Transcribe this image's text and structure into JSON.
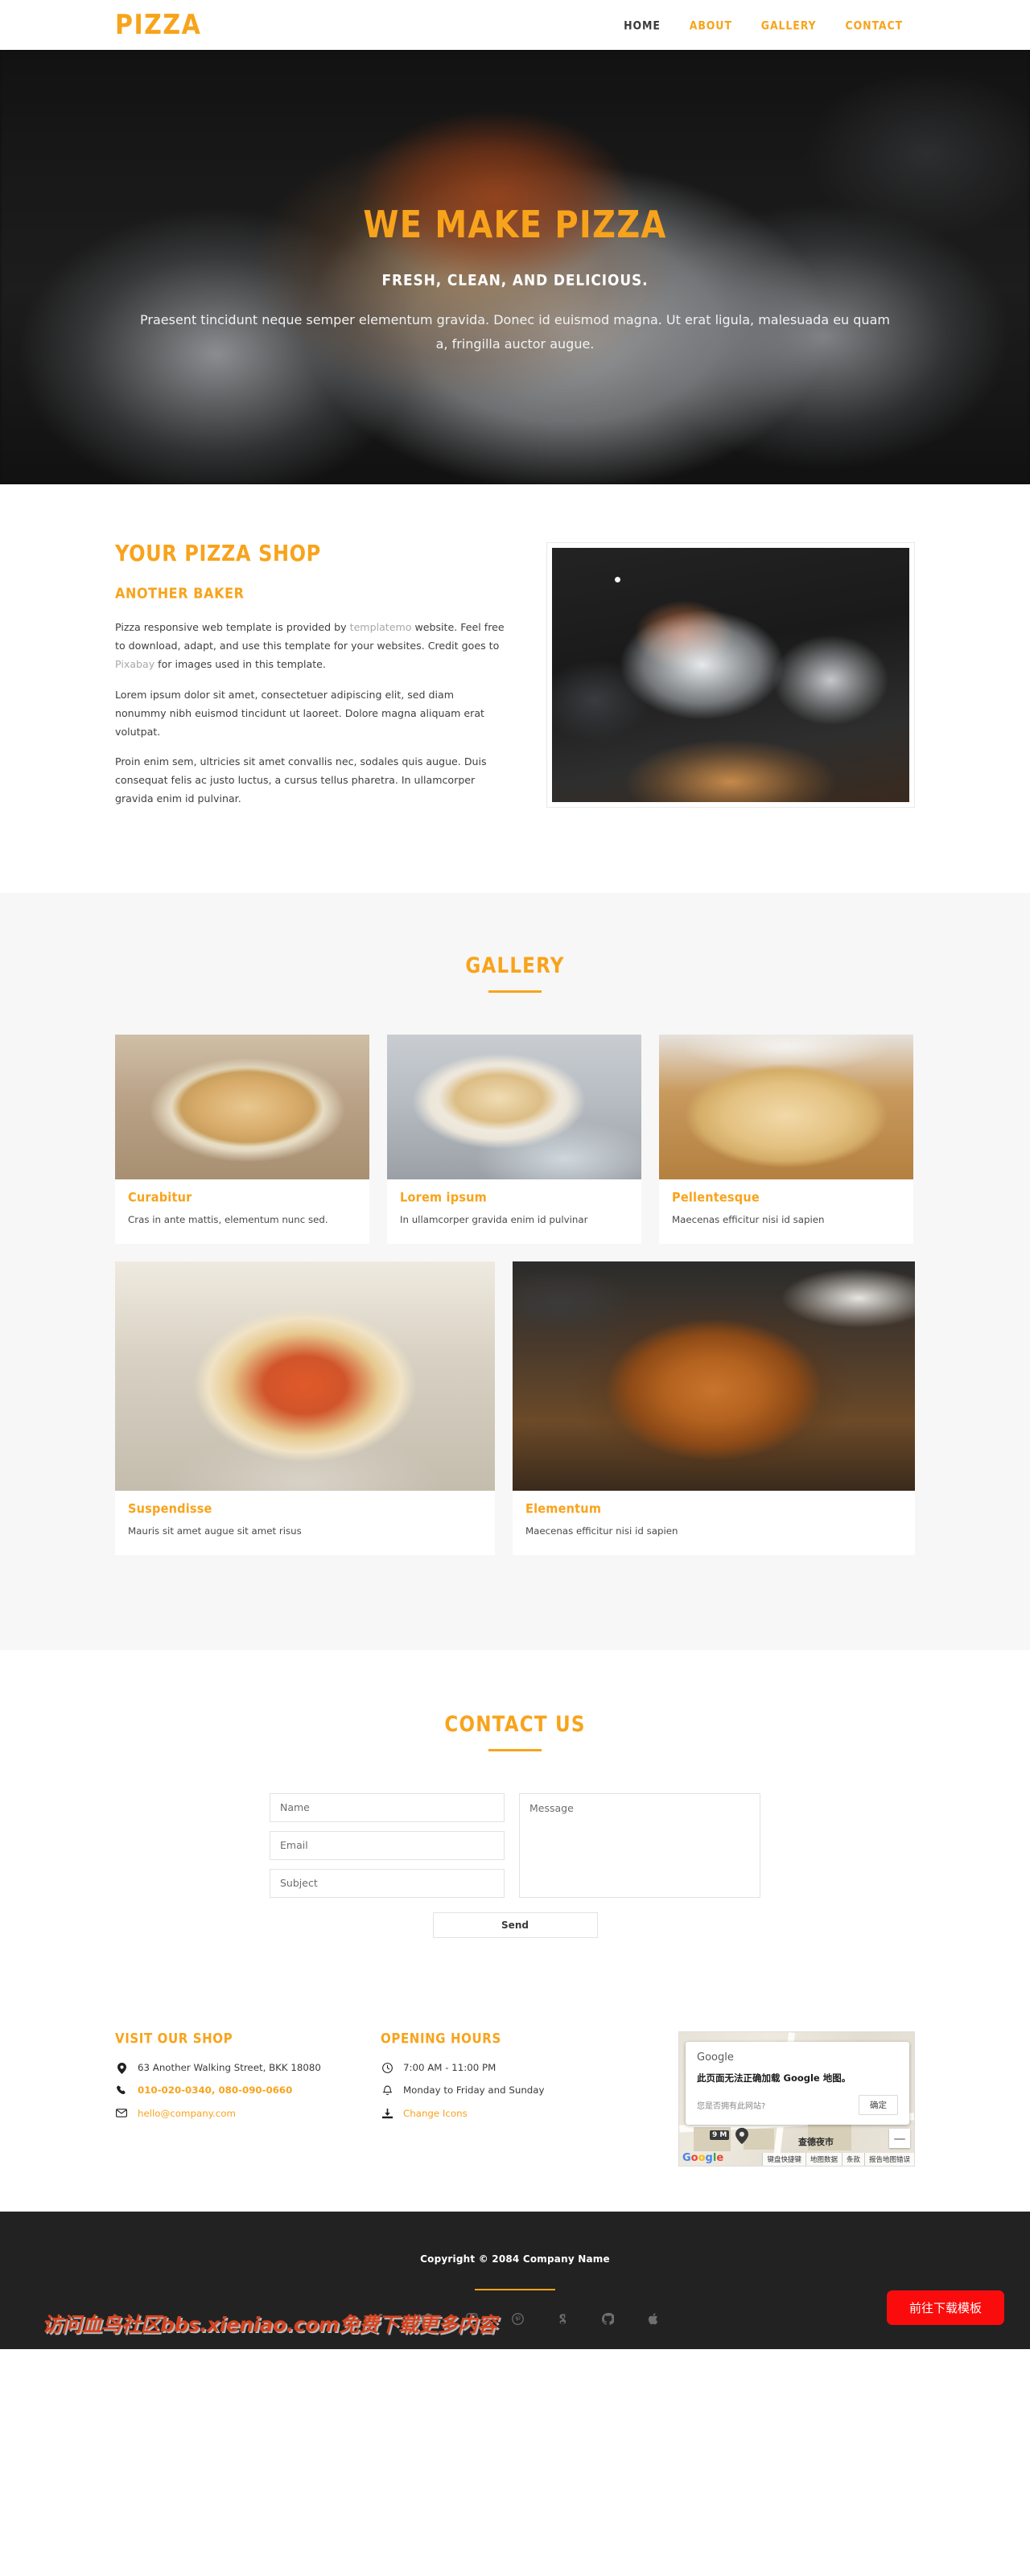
{
  "nav": {
    "brand": "PIZZA",
    "links": [
      {
        "label": "Home",
        "active": true
      },
      {
        "label": "About",
        "active": false
      },
      {
        "label": "Gallery",
        "active": false
      },
      {
        "label": "Contact",
        "active": false
      }
    ]
  },
  "hero": {
    "title": "We Make Pizza",
    "subtitle": "Fresh, Clean, and Delicious.",
    "description": "Praesent tincidunt neque semper elementum gravida. Donec id euismod magna. Ut erat ligula, malesuada eu quam a, fringilla auctor augue."
  },
  "about": {
    "title": "Your Pizza Shop",
    "subtitle": "Another Baker",
    "paragraph_1_a": "Pizza responsive web template is provided by ",
    "paragraph_1_link1": "templatemo",
    "paragraph_1_b": " website. Feel free to download, adapt, and use this template for your websites. Credit goes to ",
    "paragraph_1_link2": "Pixabay",
    "paragraph_1_c": " for images used in this template.",
    "paragraph_2": "Lorem ipsum dolor sit amet, consectetuer adipiscing elit, sed diam nonummy nibh euismod tincidunt ut laoreet. Dolore magna aliquam erat volutpat.",
    "paragraph_3": "Proin enim sem, ultricies sit amet convallis nec, sodales quis augue. Duis consequat felis ac justo luctus, a cursus tellus pharetra. In ullamcorper gravida enim id pulvinar."
  },
  "gallery": {
    "title": "Gallery",
    "row1": [
      {
        "title": "Curabitur",
        "text": "Cras in ante mattis, elementum nunc sed."
      },
      {
        "title": "Lorem ipsum",
        "text": "In ullamcorper gravida enim id pulvinar"
      },
      {
        "title": "Pellentesque",
        "text": "Maecenas efficitur nisi id sapien"
      }
    ],
    "row2": [
      {
        "title": "Suspendisse",
        "text": "Mauris sit amet augue sit amet risus"
      },
      {
        "title": "Elementum",
        "text": "Maecenas efficitur nisi id sapien"
      }
    ]
  },
  "contact": {
    "title": "Contact Us",
    "name_placeholder": "Name",
    "email_placeholder": "Email",
    "subject_placeholder": "Subject",
    "message_placeholder": "Message",
    "send_label": "Send"
  },
  "shop": {
    "title": "Visit Our Shop",
    "address": "63 Another Walking Street, BKK 18080",
    "phones": "010-020-0340, 080-090-0660",
    "email": "hello@company.com"
  },
  "hours": {
    "title": "Opening Hours",
    "time": "7:00 AM - 11:00 PM",
    "days": "Monday to Friday and Sunday",
    "change_icons": "Change Icons"
  },
  "map": {
    "brand": "Google",
    "error": "此页面无法正确加载 Google 地图。",
    "question": "您是否拥有此网站?",
    "ok": "确定",
    "zoom_out": "—",
    "logo": "Google",
    "footer_items": [
      "键盘快捷键",
      "地图数据",
      "条款",
      "报告地图错误"
    ],
    "label_market": "查德夜市",
    "label_metro": "9 M"
  },
  "footer": {
    "copyright": "Copyright © 2084 Company Name",
    "socials": [
      "facebook-icon",
      "twitter-icon",
      "instagram-icon",
      "pinterest-icon",
      "google-plus-icon",
      "github-icon",
      "apple-icon"
    ],
    "watermark": "访问血鸟社区bbs.xieniao.com免费下载更多内容",
    "download_button": "前往下载模板"
  },
  "colors": {
    "accent": "#f8a31c",
    "dark": "#222222",
    "red": "#fa0c0c"
  }
}
